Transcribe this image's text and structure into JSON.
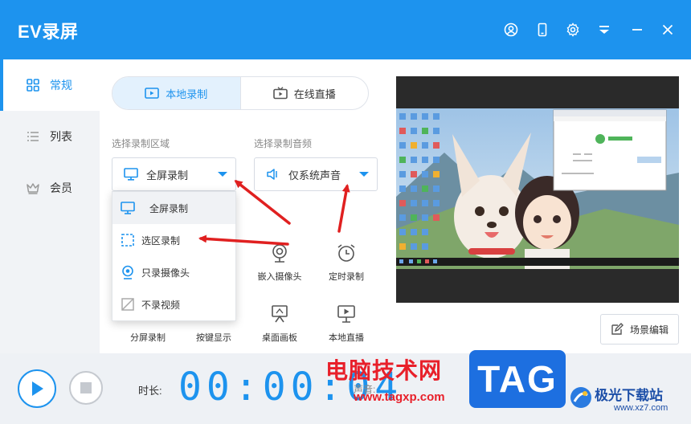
{
  "app": {
    "title": "EV录屏"
  },
  "titlebar": {
    "icons": [
      "user-icon",
      "phone-icon",
      "gear-icon",
      "skin-icon",
      "minimize-icon",
      "close-icon"
    ]
  },
  "sidebar": {
    "items": [
      {
        "label": "常规",
        "icon": "grid-icon",
        "active": true
      },
      {
        "label": "列表",
        "icon": "list-icon",
        "active": false
      },
      {
        "label": "会员",
        "icon": "crown-icon",
        "active": false
      }
    ]
  },
  "tabs": [
    {
      "label": "本地录制",
      "icon": "local-record-icon",
      "active": true
    },
    {
      "label": "在线直播",
      "icon": "tv-icon",
      "active": false
    }
  ],
  "region": {
    "label": "选择录制区域",
    "selected": "全屏录制",
    "options": [
      {
        "label": "全屏录制",
        "icon": "monitor-icon"
      },
      {
        "label": "选区录制",
        "icon": "selection-icon"
      },
      {
        "label": "只录摄像头",
        "icon": "webcam-icon"
      },
      {
        "label": "不录视频",
        "icon": "no-video-icon"
      }
    ]
  },
  "audio": {
    "label": "选择录制音频",
    "selected": "仅系统声音"
  },
  "tools": [
    {
      "label": "嵌入摄像头",
      "icon": "webcam-icon"
    },
    {
      "label": "定时录制",
      "icon": "alarm-icon"
    },
    {
      "label": "分屏录制",
      "icon": "split-icon"
    },
    {
      "label": "按键显示",
      "icon": "keyboard-icon"
    },
    {
      "label": "桌面画板",
      "icon": "easel-icon"
    },
    {
      "label": "本地直播",
      "icon": "local-live-icon"
    }
  ],
  "scene": {
    "label": "场景编辑"
  },
  "bottom": {
    "duration_label": "时长:",
    "timer": "00:00:04",
    "volume_label": "声音:"
  },
  "watermark": {
    "cn": "电脑技术网",
    "url": "www.tagxp.com",
    "tag": "TAG",
    "site_name": "极光下载站",
    "site_url": "www.xz7.com"
  },
  "colors": {
    "accent": "#1d93ee",
    "arrow": "#e02020",
    "watermark_red": "#e8202a"
  }
}
